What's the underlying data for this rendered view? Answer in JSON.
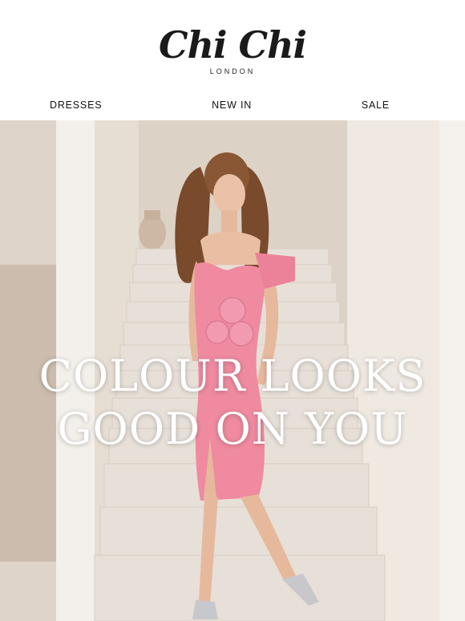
{
  "brand": {
    "logo_text": "Chi Chi",
    "logo_sub": "LONDON"
  },
  "nav": {
    "items": [
      {
        "label": "DRESSES"
      },
      {
        "label": "NEW IN"
      },
      {
        "label": "SALE"
      }
    ]
  },
  "hero": {
    "headline_line1": "COLOUR LOOKS",
    "headline_line2": "GOOD ON YOU",
    "dress_color": "#ef8aa0"
  }
}
